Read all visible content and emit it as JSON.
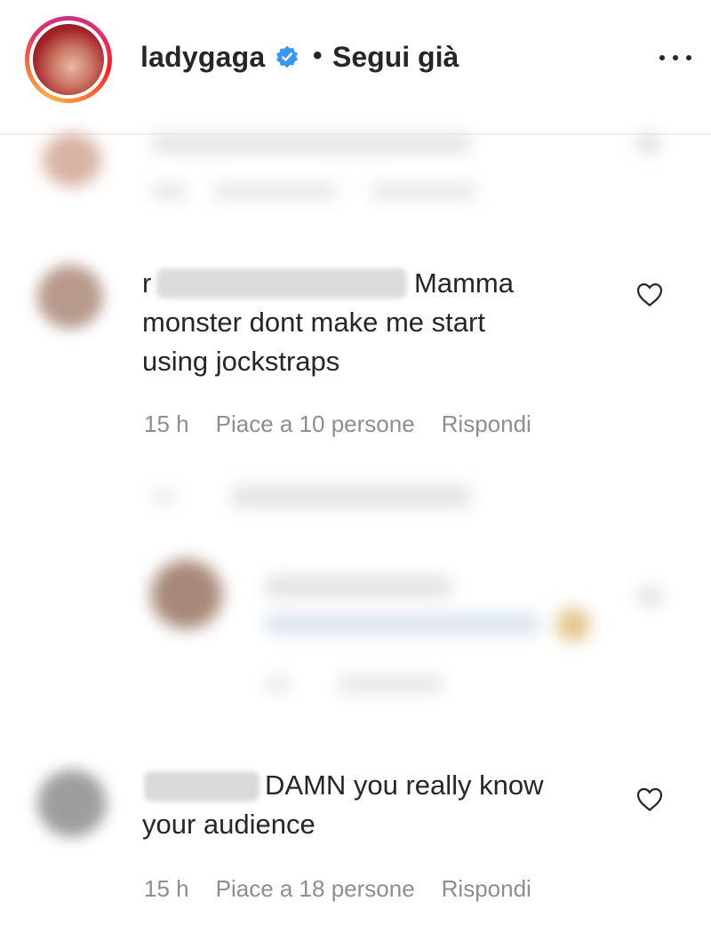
{
  "header": {
    "username": "ladygaga",
    "separator": "•",
    "follow_status": "Segui già",
    "verified_icon": "verified-badge-icon",
    "more_icon": "more-options-icon"
  },
  "comments": [
    {
      "text_start": "r",
      "text_after_redaction": "Mamma",
      "lines": [
        "monster dont make me start",
        "using jockstraps"
      ],
      "time": "15 h",
      "likes": "Piace a 10 persone",
      "reply": "Rispondi"
    },
    {
      "text_after_redaction": "DAMN you really know",
      "lines": [
        "your audience"
      ],
      "time": "15 h",
      "likes": "Piace a 18 persone",
      "reply": "Rispondi"
    }
  ],
  "colors": {
    "text": "#262626",
    "meta": "#8e8e8e",
    "verified": "#3897f0"
  }
}
